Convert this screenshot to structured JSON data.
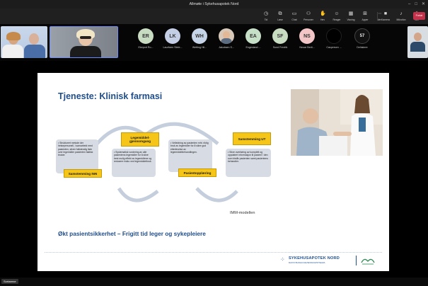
{
  "window": {
    "title": "Allmøte i Sykehusapotek Nord"
  },
  "toolbar": {
    "items": [
      {
        "label": "Tid",
        "icon": "clock-icon"
      },
      {
        "label": "Løse",
        "icon": "popout-icon"
      },
      {
        "label": "Chat",
        "icon": "chat-icon"
      },
      {
        "label": "Personer",
        "icon": "people-icon"
      },
      {
        "label": "Hev",
        "icon": "hand-icon"
      },
      {
        "label": "Reager",
        "icon": "smile-icon"
      },
      {
        "label": "Visning",
        "icon": "view-icon"
      },
      {
        "label": "Apper",
        "icon": "apps-icon"
      },
      {
        "label": "Mer",
        "icon": "more-icon"
      }
    ],
    "media": [
      {
        "label": "Kamera",
        "icon": "camera-icon"
      },
      {
        "label": "Mikrofon",
        "icon": "mic-icon"
      },
      {
        "label": "Del",
        "icon": "share-icon"
      }
    ],
    "leave_label": "Forlat"
  },
  "participants": [
    {
      "initials": "ER",
      "name": "Ekeport Ro...",
      "color": "#c8dcc2"
    },
    {
      "initials": "LK",
      "name": "Lauritzen Steie...",
      "color": "#c4cfe6"
    },
    {
      "initials": "WH",
      "name": "Wetting Hil...",
      "color": "#c6d4e8"
    },
    {
      "initials": "",
      "name": "Jakobsen S...",
      "color": "#d8c8b8"
    },
    {
      "initials": "EA",
      "name": "Engesland ...",
      "color": "#c6e0c8"
    },
    {
      "initials": "SF",
      "name": "Sund Fredrik",
      "color": "#c8dcc2"
    },
    {
      "initials": "NS",
      "name": "Neuar Berit...",
      "color": "#f2c6c6"
    },
    {
      "initials": "",
      "name": "Caspersen ...",
      "color": "#000000"
    },
    {
      "initials": "57",
      "name": "Deltakere",
      "color": "#111111"
    }
  ],
  "slide": {
    "title": "Tjeneste: Klinisk farmasi",
    "boxes": [
      {
        "text": "• Strukturert metode der helsepersonell, i samarbeid med pasienten, sikrer fullstendig liste over legemidler pasienten faktisk bruker."
      },
      {
        "text": "• Systematisk vurdering av alle pasientens legemidler for å sikre best mulig effekt av legemidlene og redusere risiko ved legemiddelbruk."
      },
      {
        "text": "• Veiledning av pasienten mht. riktig bruk av legemidler for å sikre god etterlevelse av legemiddelbehandlingen."
      },
      {
        "text": "• Sikre overføring av komplett og oppdatert informasjon til pasient / den som bistår pasienten samt pasientens behandler."
      }
    ],
    "labels": [
      {
        "text": "Samstemming INN"
      },
      {
        "text": "Legemiddel-gjennomgang"
      },
      {
        "text": "Pasientopplæring"
      },
      {
        "text": "Samstemming UT"
      }
    ],
    "model_label": "IMM-modellen",
    "footer": "Økt pasientsikkerhet – Frigitt tid leger og sykepleiere",
    "logo": "SYKEHUSAPOTEK NORD",
    "logo_sub": "DAVVI BUOHCCEVIESSOAPOTEAVA"
  },
  "video": {
    "presenter_name": "Sortarene"
  }
}
